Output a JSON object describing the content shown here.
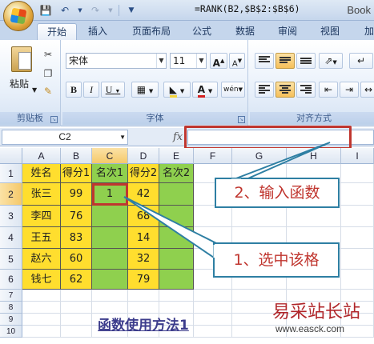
{
  "window": {
    "title": "Book"
  },
  "quick_access": {
    "icons": [
      "save-icon",
      "undo-icon",
      "redo-icon",
      "customize-icon"
    ]
  },
  "tabs": [
    "开始",
    "插入",
    "页面布局",
    "公式",
    "数据",
    "审阅",
    "视图",
    "加"
  ],
  "active_tab": "开始",
  "ribbon": {
    "clipboard": {
      "label": "剪贴板",
      "paste_label": "粘贴"
    },
    "font": {
      "label": "字体",
      "font_name": "宋体",
      "font_size": "11"
    },
    "alignment": {
      "label": "对齐方式"
    }
  },
  "formula_bar": {
    "name_box": "C2",
    "fx_label": "fx",
    "formula": "=RANK(B2,$B$2:$B$6)"
  },
  "sheet": {
    "columns": [
      "A",
      "B",
      "C",
      "D",
      "E",
      "F",
      "G",
      "H",
      "I"
    ],
    "rows": [
      "1",
      "2",
      "3",
      "4",
      "5",
      "6",
      "7",
      "8",
      "9",
      "10"
    ],
    "header_row": [
      "姓名",
      "得分1",
      "名次1",
      "得分2",
      "名次2"
    ],
    "data": [
      [
        "张三",
        "99",
        "1",
        "42",
        ""
      ],
      [
        "李四",
        "76",
        "",
        "68",
        ""
      ],
      [
        "王五",
        "83",
        "",
        "14",
        ""
      ],
      [
        "赵六",
        "60",
        "",
        "32",
        ""
      ],
      [
        "钱七",
        "62",
        "",
        "79",
        ""
      ]
    ],
    "caption": "函数使用方法1"
  },
  "annotations": {
    "step2": "2、输入函数",
    "step1": "1、选中该格"
  },
  "watermark": {
    "name": "易采站长站",
    "url": "www.easck.com"
  },
  "colors": {
    "highlight_red": "#c0362f",
    "cell_yellow": "#ffde2e",
    "cell_green": "#8fd04e",
    "callout_border": "#2e7fa3"
  }
}
